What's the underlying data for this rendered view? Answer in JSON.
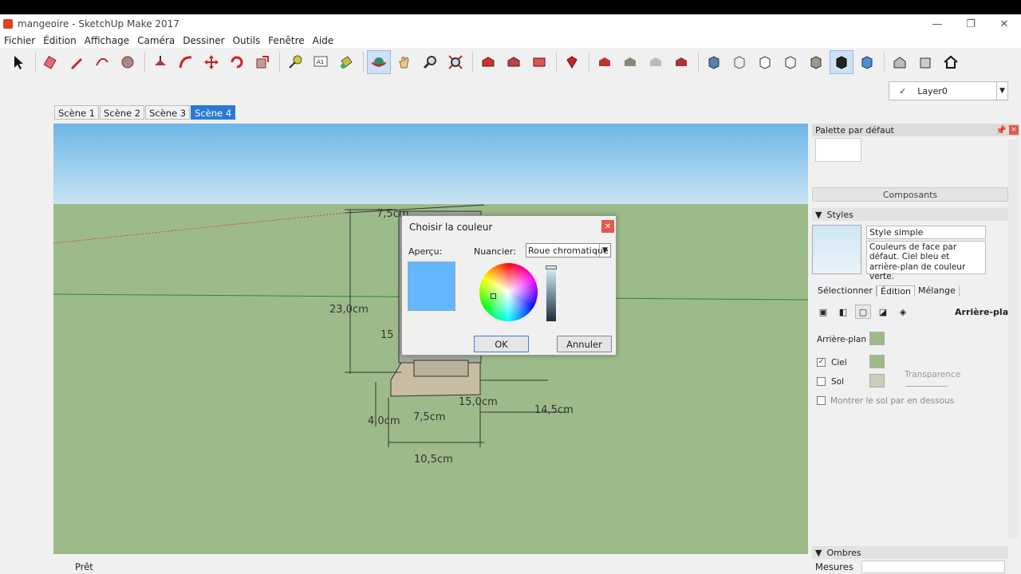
{
  "window": {
    "title": "mangeoire - SketchUp Make 2017"
  },
  "menu": [
    "Fichier",
    "Édition",
    "Affichage",
    "Caméra",
    "Dessiner",
    "Outils",
    "Fenêtre",
    "Aide"
  ],
  "layer": {
    "name": "Layer0"
  },
  "scenes": [
    "Scène 1",
    "Scène 2",
    "Scène 3",
    "Scène 4"
  ],
  "dimensions": [
    "7,5cm",
    "23,0cm",
    "15",
    "15,0cm",
    "14,5cm",
    "4,0cm",
    "7,5cm",
    "10,5cm"
  ],
  "dialog": {
    "title": "Choisir la couleur",
    "apercu_label": "Aperçu:",
    "nuancer_label": "Nuancier:",
    "nuancer_value": "Roue chromatique",
    "ok_label": "OK",
    "cancel_label": "Annuler",
    "preview_color": "#64b6ff"
  },
  "panel": {
    "title": "Palette par défaut",
    "components_label": "Composants",
    "styles_label": "Styles",
    "style_name": "Style simple",
    "style_desc": "Couleurs de face par défaut. Ciel bleu et arrière-plan de couleur verte.",
    "tabs": [
      "Sélectionner",
      "Édition",
      "Mélange"
    ],
    "section_title": "Arrière-plan",
    "background_label": "Arrière-plan",
    "sky_label": "Ciel",
    "ground_label": "Sol",
    "transparency_label": "Transparence",
    "show_ground_label": "Montrer le sol par en dessous",
    "shadow_label": "Ombres"
  },
  "status": {
    "text": "Prêt",
    "measures_label": "Mesures"
  },
  "colors": {
    "sky": "#6cb6e6",
    "ground": "#9dbb8a",
    "swatch_bg": "#9dbb8a",
    "swatch_sky": "#9dbb8a",
    "swatch_ground": "#c8d0b8"
  }
}
